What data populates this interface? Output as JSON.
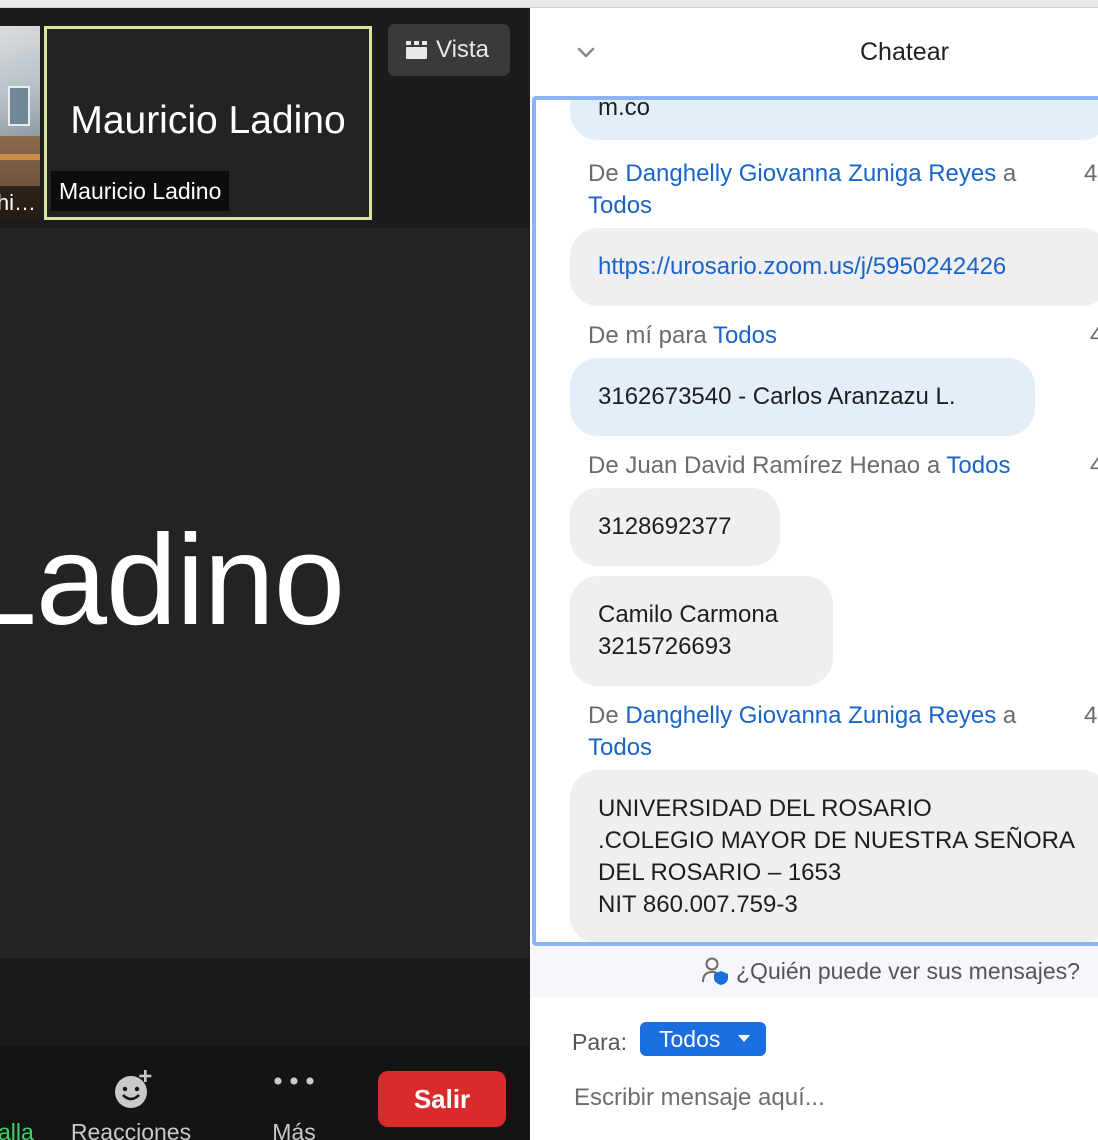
{
  "video": {
    "layout_button_label": "Vista",
    "participants": [
      {
        "name_truncated": "hi…",
        "has_camera": true
      },
      {
        "display_name": "Mauricio Ladino",
        "name_label": "Mauricio Ladino",
        "active_speaker": true
      }
    ],
    "main_speaker_text": "Ladino",
    "toolbar": {
      "share_label": "alla",
      "reactions_label": "Reacciones",
      "more_label": "Más",
      "leave_label": "Salir"
    },
    "colors": {
      "leave": "#d92b2b",
      "share_green": "#39d46a",
      "active_border": "#d6e7a0"
    }
  },
  "chat": {
    "title": "Chatear",
    "top_partial_text": "m.co",
    "messages": [
      {
        "from_prefix": "De",
        "sender": "Danghelly Giovanna Zuniga Reyes",
        "joiner": "a",
        "recipient": "Todos",
        "time_partial": "4",
        "text": "https://urosario.zoom.us/j/5950242426",
        "is_link": true
      },
      {
        "from_prefix": "De mí para",
        "recipient": "Todos",
        "time_partial": "4",
        "text": "3162673540 - Carlos Aranzazu L.",
        "mine": true
      },
      {
        "header": "De Juan David Ramírez Henao a",
        "recipient": "Todos",
        "time_partial": "4",
        "texts": [
          "3128692377",
          "Camilo Carmona",
          "3215726693"
        ]
      },
      {
        "from_prefix": "De",
        "sender": "Danghelly Giovanna Zuniga Reyes",
        "joiner": "a",
        "recipient": "Todos",
        "time_partial": "4",
        "lines": [
          "UNIVERSIDAD DEL ROSARIO",
          ".COLEGIO MAYOR DE NUESTRA SEÑORA",
          "DEL ROSARIO – 1653",
          "NIT 860.007.759-3"
        ]
      }
    ],
    "privacy_text": "¿Quién puede ver sus mensajes?",
    "to_label": "Para:",
    "to_value": "Todos",
    "input_placeholder": "Escribir mensaje aquí...",
    "colors": {
      "link": "#1a64c8",
      "focus_border": "#8cb3f4",
      "to_button": "#1a6ee0"
    }
  }
}
